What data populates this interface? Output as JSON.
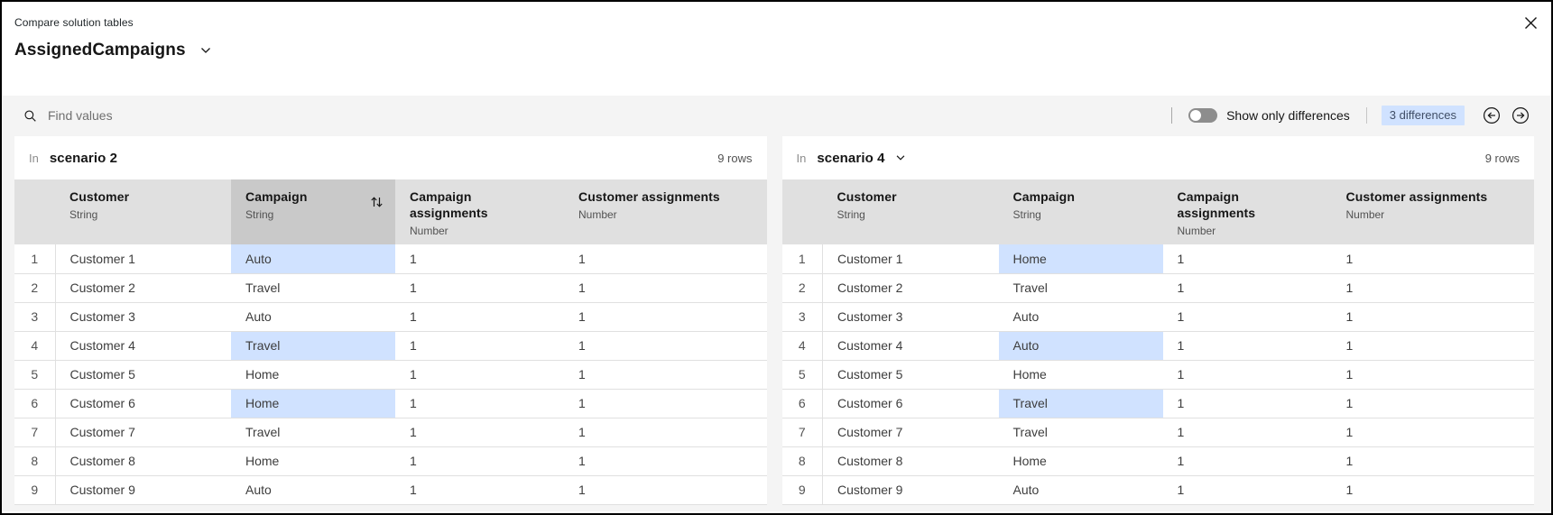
{
  "dialog": {
    "eyebrow": "Compare solution tables",
    "table_selector": "AssignedCampaigns"
  },
  "toolbar": {
    "search_placeholder": "Find values",
    "show_only_differences_label": "Show only differences",
    "differences_badge": "3 differences"
  },
  "columns": [
    {
      "label": "Customer",
      "type": "String"
    },
    {
      "label": "Campaign",
      "type": "String"
    },
    {
      "label": "Campaign assignments",
      "type": "Number"
    },
    {
      "label": "Customer assignments",
      "type": "Number"
    }
  ],
  "left_panel": {
    "in_label": "In",
    "scenario_name": "scenario 2",
    "row_count": "9 rows",
    "rows": [
      {
        "n": "1",
        "customer": "Customer 1",
        "campaign": "Auto",
        "campaign_assignments": "1",
        "customer_assignments": "1",
        "diff": true
      },
      {
        "n": "2",
        "customer": "Customer 2",
        "campaign": "Travel",
        "campaign_assignments": "1",
        "customer_assignments": "1",
        "diff": false
      },
      {
        "n": "3",
        "customer": "Customer 3",
        "campaign": "Auto",
        "campaign_assignments": "1",
        "customer_assignments": "1",
        "diff": false
      },
      {
        "n": "4",
        "customer": "Customer 4",
        "campaign": "Travel",
        "campaign_assignments": "1",
        "customer_assignments": "1",
        "diff": true
      },
      {
        "n": "5",
        "customer": "Customer 5",
        "campaign": "Home",
        "campaign_assignments": "1",
        "customer_assignments": "1",
        "diff": false
      },
      {
        "n": "6",
        "customer": "Customer 6",
        "campaign": "Home",
        "campaign_assignments": "1",
        "customer_assignments": "1",
        "diff": true
      },
      {
        "n": "7",
        "customer": "Customer 7",
        "campaign": "Travel",
        "campaign_assignments": "1",
        "customer_assignments": "1",
        "diff": false
      },
      {
        "n": "8",
        "customer": "Customer 8",
        "campaign": "Home",
        "campaign_assignments": "1",
        "customer_assignments": "1",
        "diff": false
      },
      {
        "n": "9",
        "customer": "Customer 9",
        "campaign": "Auto",
        "campaign_assignments": "1",
        "customer_assignments": "1",
        "diff": false
      }
    ]
  },
  "right_panel": {
    "in_label": "In",
    "scenario_name": "scenario 4",
    "row_count": "9 rows",
    "rows": [
      {
        "n": "1",
        "customer": "Customer 1",
        "campaign": "Home",
        "campaign_assignments": "1",
        "customer_assignments": "1",
        "diff": true
      },
      {
        "n": "2",
        "customer": "Customer 2",
        "campaign": "Travel",
        "campaign_assignments": "1",
        "customer_assignments": "1",
        "diff": false
      },
      {
        "n": "3",
        "customer": "Customer 3",
        "campaign": "Auto",
        "campaign_assignments": "1",
        "customer_assignments": "1",
        "diff": false
      },
      {
        "n": "4",
        "customer": "Customer 4",
        "campaign": "Auto",
        "campaign_assignments": "1",
        "customer_assignments": "1",
        "diff": true
      },
      {
        "n": "5",
        "customer": "Customer 5",
        "campaign": "Home",
        "campaign_assignments": "1",
        "customer_assignments": "1",
        "diff": false
      },
      {
        "n": "6",
        "customer": "Customer 6",
        "campaign": "Travel",
        "campaign_assignments": "1",
        "customer_assignments": "1",
        "diff": true
      },
      {
        "n": "7",
        "customer": "Customer 7",
        "campaign": "Travel",
        "campaign_assignments": "1",
        "customer_assignments": "1",
        "diff": false
      },
      {
        "n": "8",
        "customer": "Customer 8",
        "campaign": "Home",
        "campaign_assignments": "1",
        "customer_assignments": "1",
        "diff": false
      },
      {
        "n": "9",
        "customer": "Customer 9",
        "campaign": "Auto",
        "campaign_assignments": "1",
        "customer_assignments": "1",
        "diff": false
      }
    ]
  },
  "colors": {
    "diff_highlight": "#d0e2ff",
    "badge_bg": "#d0e2ff",
    "badge_text": "#404e66",
    "header_row_bg": "#e0e0e0",
    "sorted_column_bg": "#c9c9c9",
    "page_bg": "#f4f4f4",
    "toggle_off": "#8d8d8d"
  }
}
